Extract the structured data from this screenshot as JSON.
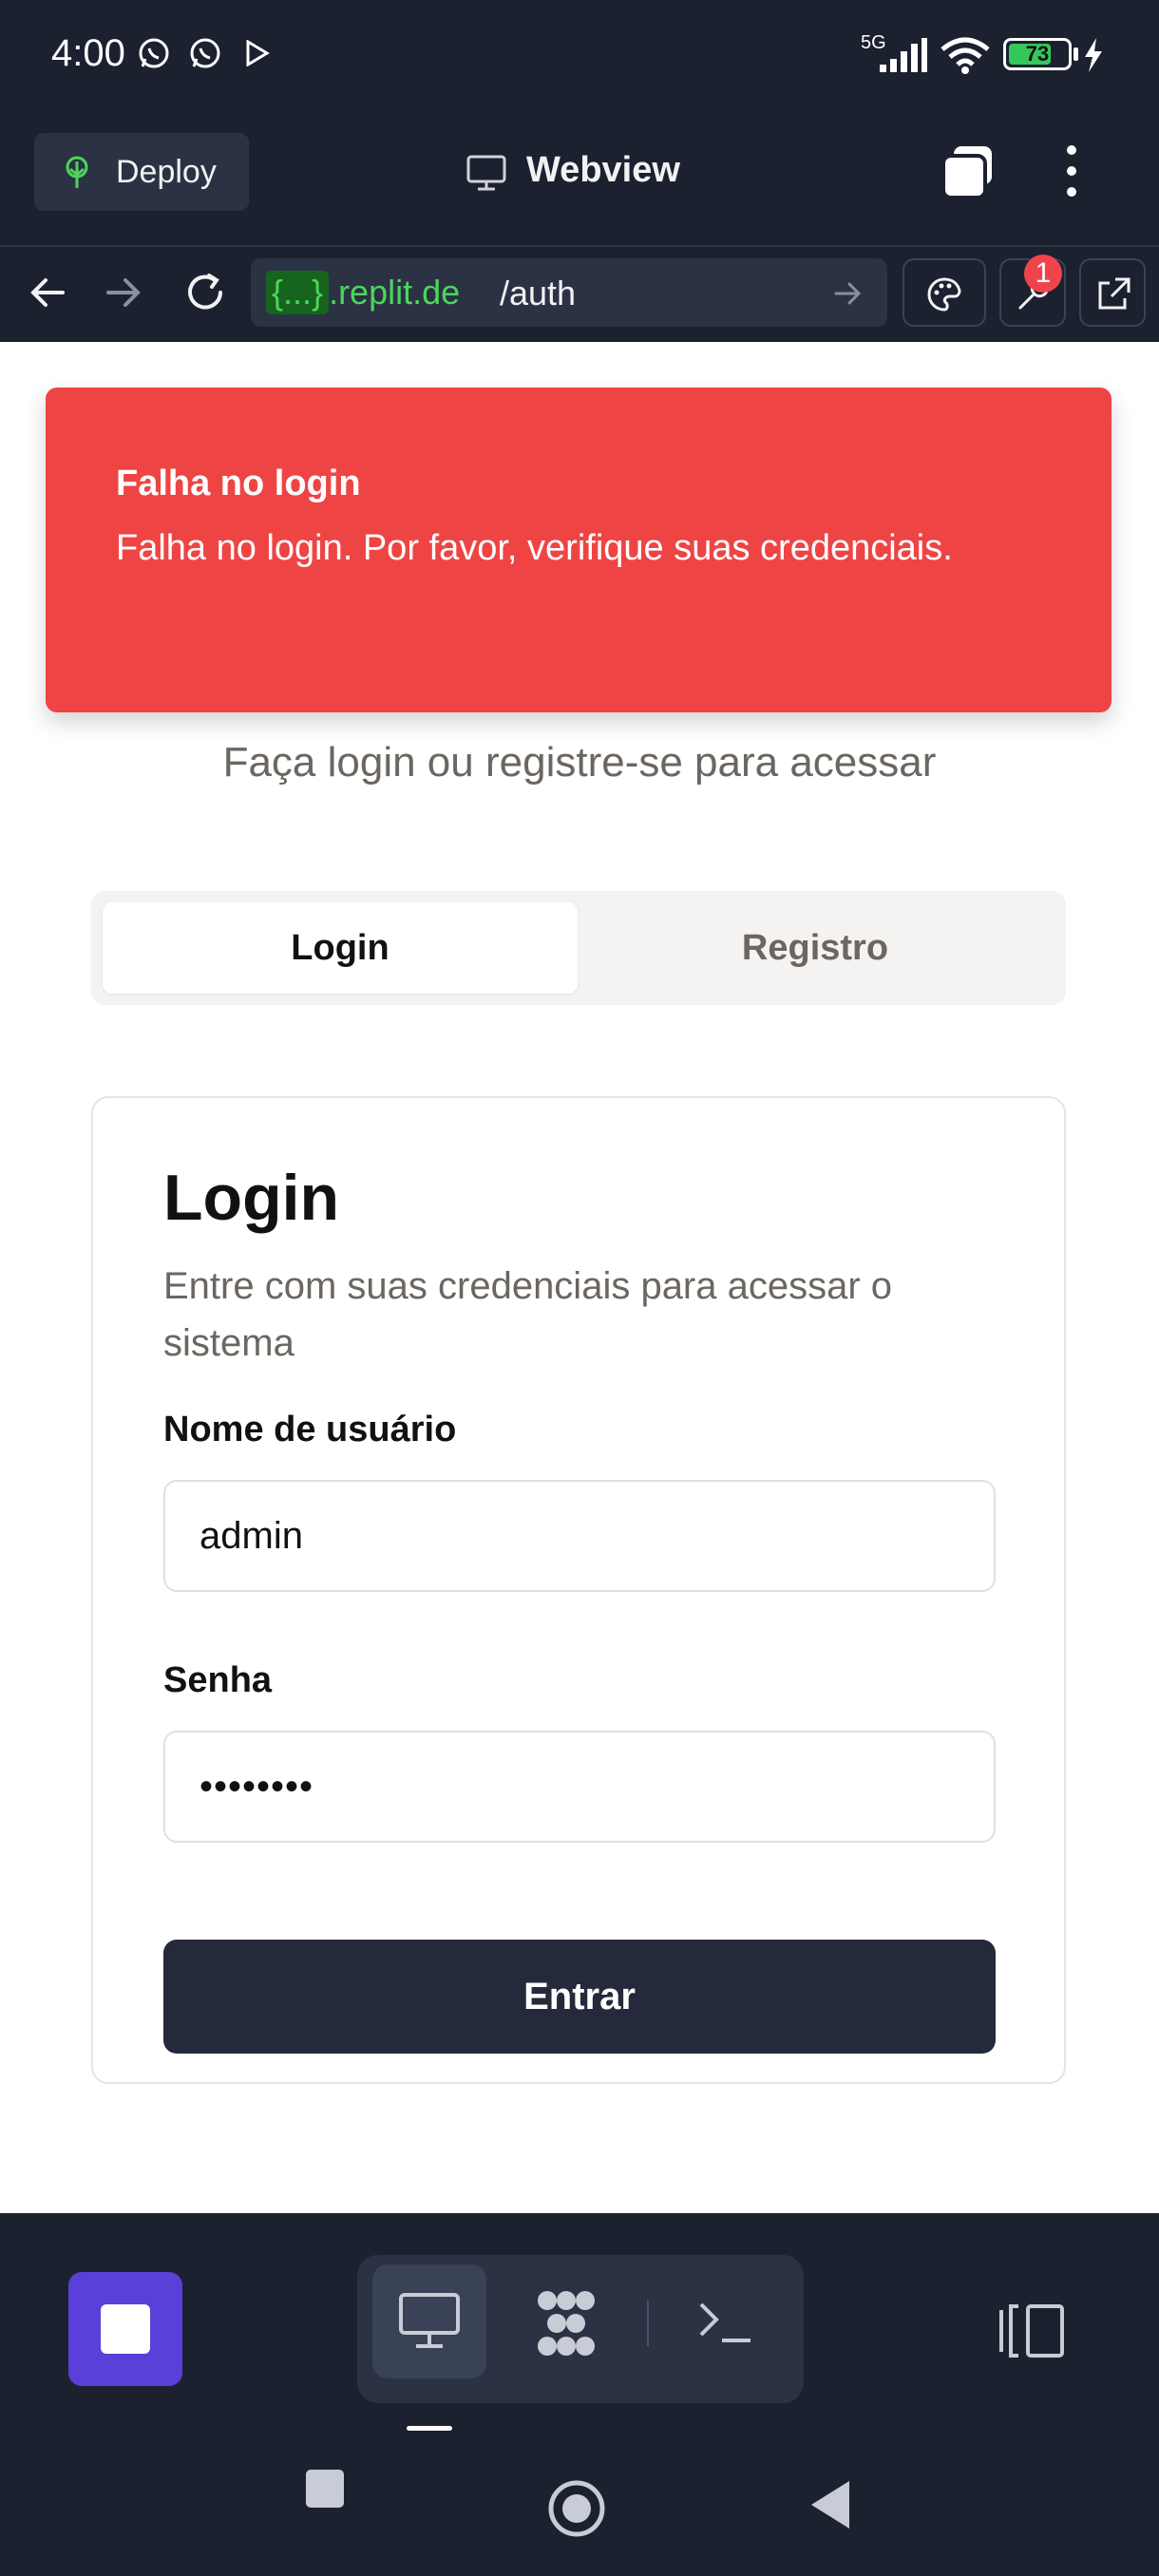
{
  "status_bar": {
    "time": "4:00",
    "network": "5G",
    "battery_percent": 73,
    "battery_label": "73"
  },
  "header": {
    "deploy_label": "Deploy",
    "title": "Webview"
  },
  "url_bar": {
    "host_tag": "{...}",
    "host": ".replit.de",
    "path": "/auth",
    "notification_count": "1"
  },
  "toast": {
    "title": "Falha no login",
    "message": "Falha no login. Por favor, verifique suas credenciais."
  },
  "page": {
    "subtitle": "Faça login ou registre-se para acessar",
    "tabs": [
      {
        "label": "Login",
        "selected": true
      },
      {
        "label": "Registro",
        "selected": false
      }
    ]
  },
  "login_card": {
    "title": "Login",
    "description": "Entre com suas credenciais para acessar o sistema",
    "username_label": "Nome de usuário",
    "username_value": "admin",
    "password_label": "Senha",
    "password_value": "••••••••",
    "submit_label": "Entrar"
  },
  "colors": {
    "toast_bg": "#ef4444",
    "accent": "#5a3fd8",
    "button_dark": "#242a3b",
    "url_green": "#4cd65a"
  },
  "icons": {
    "deploy": "deploy-tree-icon",
    "webview": "monitor-icon",
    "tabs": "tabs-icon",
    "more": "more-vertical-icon",
    "back": "arrow-left-icon",
    "forward": "arrow-right-icon",
    "reload": "reload-icon",
    "palette": "palette-icon",
    "devtools": "wrench-icon",
    "open_external": "external-link-icon"
  }
}
